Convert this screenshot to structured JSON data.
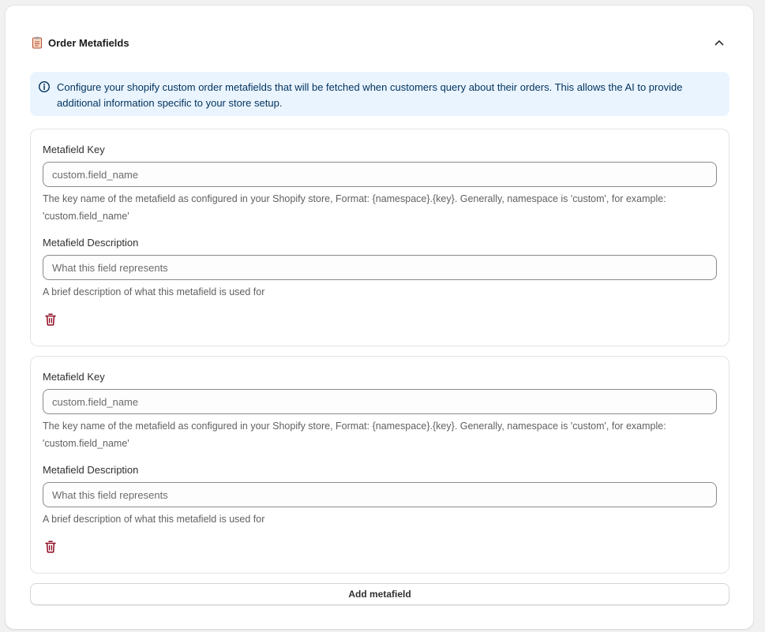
{
  "section": {
    "title": "Order Metafields",
    "title_icon": "clipboard-icon",
    "collapse_icon": "chevron-up-icon"
  },
  "info_banner": {
    "icon": "info-icon",
    "text": "Configure your shopify custom order metafields that will be fetched when customers query about their orders. This allows the AI to provide additional information specific to your store setup."
  },
  "metafields": [
    {
      "key_label": "Metafield Key",
      "key_placeholder": "custom.field_name",
      "key_value": "",
      "key_help": "The key name of the metafield as configured in your Shopify store, Format: {namespace}.{key}. Generally, namespace is 'custom', for example: 'custom.field_name'",
      "desc_label": "Metafield Description",
      "desc_placeholder": "What this field represents",
      "desc_value": "",
      "desc_help": "A brief description of what this metafield is used for",
      "delete_icon": "trash-icon"
    },
    {
      "key_label": "Metafield Key",
      "key_placeholder": "custom.field_name",
      "key_value": "",
      "key_help": "The key name of the metafield as configured in your Shopify store, Format: {namespace}.{key}. Generally, namespace is 'custom', for example: 'custom.field_name'",
      "desc_label": "Metafield Description",
      "desc_placeholder": "What this field represents",
      "desc_value": "",
      "desc_help": "A brief description of what this metafield is used for",
      "delete_icon": "trash-icon"
    }
  ],
  "add_button": {
    "label": "Add metafield"
  },
  "colors": {
    "banner_bg": "#eaf4ff",
    "banner_text": "#00325c",
    "delete_icon": "#8e0b21"
  }
}
